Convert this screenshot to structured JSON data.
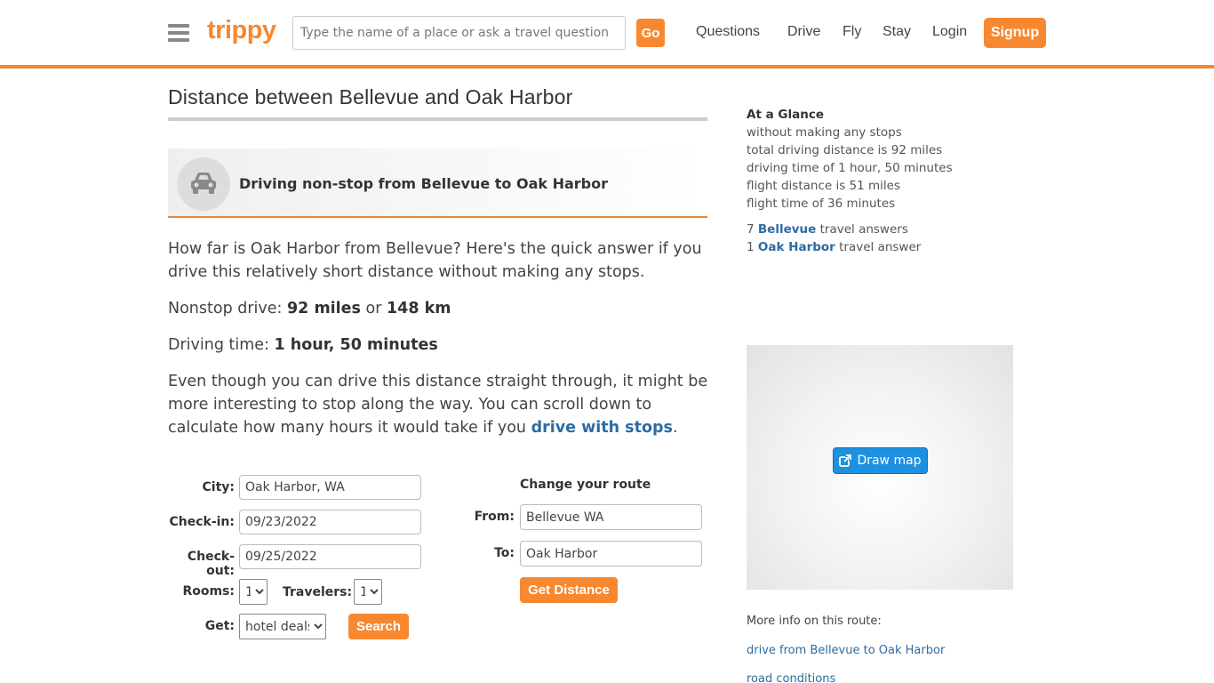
{
  "header": {
    "logo": "trippy",
    "search_placeholder": "Type the name of a place or ask a travel question",
    "go_label": "Go",
    "nav": [
      "Questions",
      "Drive",
      "Fly",
      "Stay",
      "Login"
    ],
    "signup_label": "Signup",
    "accent_color": "#f78830"
  },
  "main": {
    "title": "Distance between Bellevue and Oak Harbor",
    "drive_heading": "Driving non-stop from Bellevue to Oak Harbor",
    "intro": "How far is Oak Harbor from Bellevue? Here's the quick answer if you drive this relatively short distance without making any stops.",
    "nonstop": {
      "label": "Nonstop drive: ",
      "miles": "92 miles",
      "or": " or ",
      "km": "148 km"
    },
    "driving_time": {
      "label": "Driving time: ",
      "value": "1 hour, 50 minutes"
    },
    "outro": {
      "text": "Even though you can drive this distance straight through, it might be more interesting to stop along the way. You can scroll down to calculate how many hours it would take if you ",
      "link": "drive with stops",
      "end": "."
    }
  },
  "hotel_form": {
    "city_label": "City:",
    "city_value": "Oak Harbor, WA",
    "checkin_label": "Check-in:",
    "checkin_value": "09/23/2022",
    "checkout_label": "Check-out:",
    "checkout_value": "09/25/2022",
    "rooms_label": "Rooms:",
    "rooms_value": "1",
    "travelers_label": "Travelers:",
    "travelers_value": "1",
    "get_label": "Get:",
    "get_value": "hotel deals",
    "search_label": "Search"
  },
  "route_form": {
    "heading": "Change your route",
    "from_label": "From:",
    "from_value": "Bellevue WA",
    "to_label": "To:",
    "to_value": "Oak Harbor",
    "submit_label": "Get Distance"
  },
  "sidebar": {
    "glance_title": "At a Glance",
    "glance_lines": [
      "without making any stops",
      "total driving distance is 92 miles",
      "driving time of 1 hour, 50 minutes",
      "flight distance is 51 miles",
      "flight time of 36 minutes"
    ],
    "answers": [
      {
        "count": "7 ",
        "link": "Bellevue",
        "suffix": " travel answers"
      },
      {
        "count": "1 ",
        "link": "Oak Harbor",
        "suffix": " travel answer"
      }
    ],
    "draw_map_label": "Draw map",
    "more_info_label": "More info on this route:",
    "links": [
      "drive from Bellevue to Oak Harbor",
      "road conditions"
    ]
  }
}
